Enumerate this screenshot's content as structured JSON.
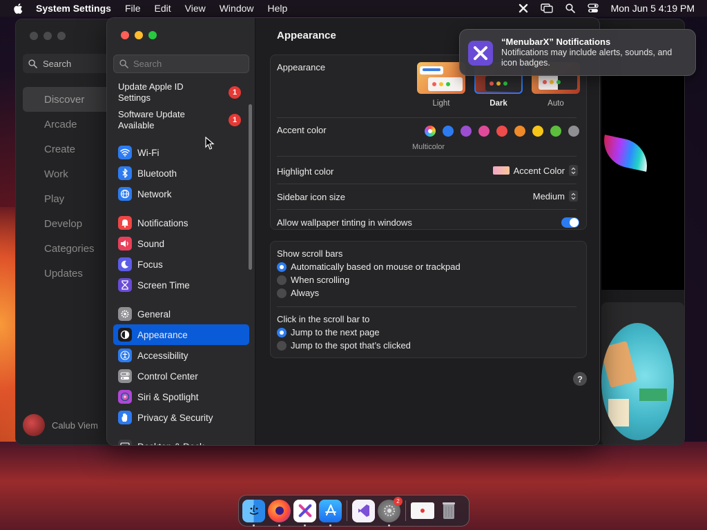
{
  "menubar": {
    "items": [
      "System Settings",
      "File",
      "Edit",
      "View",
      "Window",
      "Help"
    ],
    "clock": "Mon Jun 5  4:19 PM"
  },
  "appstore": {
    "search_label": "Search",
    "nav": [
      "Discover",
      "Arcade",
      "Create",
      "Work",
      "Play",
      "Develop",
      "Categories",
      "Updates"
    ],
    "user_name": "Calub Viem"
  },
  "settings": {
    "search_placeholder": "Search",
    "updates": [
      {
        "label": "Update Apple ID Settings",
        "badge": "1"
      },
      {
        "label": "Software Update Available",
        "badge": "1"
      }
    ],
    "nav_groups": [
      [
        {
          "label": "Wi-Fi",
          "icon": "wifi-icon",
          "color": "#2d7bf0"
        },
        {
          "label": "Bluetooth",
          "icon": "bluetooth-icon",
          "color": "#2d7bf0"
        },
        {
          "label": "Network",
          "icon": "globe-icon",
          "color": "#2d7bf0"
        }
      ],
      [
        {
          "label": "Notifications",
          "icon": "bell-icon",
          "color": "#ef4545"
        },
        {
          "label": "Sound",
          "icon": "speaker-icon",
          "color": "#e8405a"
        },
        {
          "label": "Focus",
          "icon": "moon-icon",
          "color": "#5e5ce6"
        },
        {
          "label": "Screen Time",
          "icon": "hourglass-icon",
          "color": "#6a4bd6"
        }
      ],
      [
        {
          "label": "General",
          "icon": "gear-icon",
          "color": "#8e8e93"
        },
        {
          "label": "Appearance",
          "icon": "appearance-icon",
          "color": "#1c1c1e",
          "active": true
        },
        {
          "label": "Accessibility",
          "icon": "accessibility-icon",
          "color": "#2d7bf0"
        },
        {
          "label": "Control Center",
          "icon": "control-center-icon",
          "color": "#8e8e93"
        },
        {
          "label": "Siri & Spotlight",
          "icon": "siri-icon",
          "color": "#b048d8"
        },
        {
          "label": "Privacy & Security",
          "icon": "hand-icon",
          "color": "#2d7bf0"
        }
      ],
      [
        {
          "label": "Desktop & Dock",
          "icon": "dock-icon",
          "color": "#3a3a3c"
        }
      ]
    ],
    "title": "Appearance",
    "appearance": {
      "label": "Appearance",
      "options": [
        "Light",
        "Dark",
        "Auto"
      ],
      "selected": "Dark"
    },
    "accent": {
      "label": "Accent color",
      "colors": [
        "#2d7bf0",
        "#9b4fd0",
        "#e04a9a",
        "#ee4b4b",
        "#f08a2a",
        "#f5c518",
        "#5bbe3c",
        "#8e8e93"
      ],
      "selected_label": "Multicolor"
    },
    "highlight": {
      "label": "Highlight color",
      "value": "Accent Color"
    },
    "icon_size": {
      "label": "Sidebar icon size",
      "value": "Medium"
    },
    "tinting": {
      "label": "Allow wallpaper tinting in windows",
      "on": true
    },
    "scrollbars": {
      "label": "Show scroll bars",
      "options": [
        "Automatically based on mouse or trackpad",
        "When scrolling",
        "Always"
      ],
      "selected": 0
    },
    "click_scroll": {
      "label": "Click in the scroll bar to",
      "options": [
        "Jump to the next page",
        "Jump to the spot that’s clicked"
      ],
      "selected": 0
    },
    "help": "?"
  },
  "notification": {
    "title": "“MenubarX” Notifications",
    "body": "Notifications may include alerts, sounds, and icon badges."
  },
  "dock": {
    "apps": [
      "finder-icon",
      "firefox-icon",
      "menubarx-icon",
      "app-store-icon",
      "visual-studio-icon",
      "system-settings-icon",
      "preview-icon",
      "trash-icon"
    ],
    "settings_badge": "2"
  }
}
